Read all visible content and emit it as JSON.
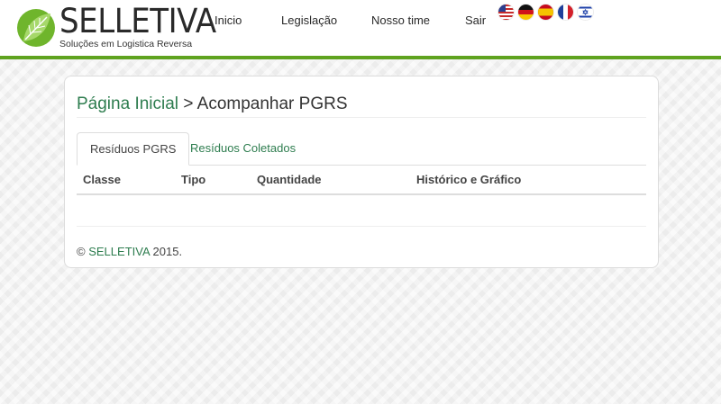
{
  "brand": {
    "name": "SELLETIVA",
    "tagline": "Soluções em Logistica Reversa",
    "colors": {
      "accent": "#5fa31f",
      "link": "#2e7d4f"
    }
  },
  "nav": {
    "items": [
      {
        "label": "Inicio"
      },
      {
        "label": "Legislação"
      },
      {
        "label": "Nosso time"
      },
      {
        "label": "Sair"
      }
    ],
    "flags": [
      "us-flag-icon",
      "de-flag-icon",
      "es-flag-icon",
      "fr-flag-icon",
      "il-flag-icon"
    ]
  },
  "breadcrumb": {
    "home": "Página Inicial",
    "separator": ">",
    "current": "Acompanhar PGRS"
  },
  "tabs": [
    {
      "label": "Resíduos PGRS",
      "active": true
    },
    {
      "label": "Resíduos Coletados",
      "active": false
    }
  ],
  "table": {
    "columns": [
      "Classe",
      "Tipo",
      "Quantidade",
      "Histórico e Gráfico"
    ],
    "rows": []
  },
  "footer": {
    "copyright": "©",
    "brand": "SELLETIVA",
    "year": "2015."
  }
}
